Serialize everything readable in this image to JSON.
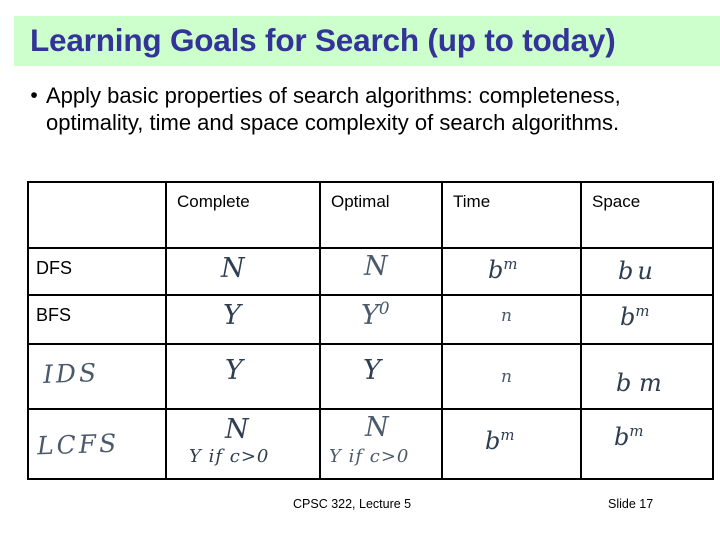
{
  "slide": {
    "title": "Learning Goals for Search  (up to today)",
    "banner_color": "#ccffcc",
    "title_color": "#333399"
  },
  "bullets": [
    {
      "marker": "•",
      "text": "Apply basic properties of search algorithms: completeness, optimality, time and space complexity of search algorithms."
    }
  ],
  "table": {
    "corner_label": "",
    "columns": [
      "Complete",
      "Optimal",
      "Time",
      "Space"
    ],
    "rows": [
      {
        "label": "DFS",
        "label_handwritten": false,
        "cells": [
          {
            "main": "N",
            "sup": "",
            "cond": ""
          },
          {
            "main": "N",
            "sup": "",
            "cond": ""
          },
          {
            "main": "b",
            "sup": "m",
            "cond": ""
          },
          {
            "main": "b",
            "sup": "",
            "cond": "",
            "extra": "u"
          }
        ]
      },
      {
        "label": "BFS",
        "label_handwritten": false,
        "cells": [
          {
            "main": "Y",
            "sup": "",
            "cond": ""
          },
          {
            "main": "Y",
            "sup": "0",
            "cond": ""
          },
          {
            "main": "n",
            "sup": "",
            "cond": ""
          },
          {
            "main": "b",
            "sup": "m",
            "cond": ""
          }
        ]
      },
      {
        "label": "IDS",
        "label_handwritten": true,
        "cells": [
          {
            "main": "Y",
            "sup": "",
            "cond": ""
          },
          {
            "main": "Y",
            "sup": "",
            "cond": ""
          },
          {
            "main": "n",
            "sup": "",
            "cond": ""
          },
          {
            "main": "b m",
            "sup": "",
            "cond": ""
          }
        ]
      },
      {
        "label": "LCFS",
        "label_handwritten": true,
        "cells": [
          {
            "main": "N",
            "sup": "",
            "cond": "Y if c>0"
          },
          {
            "main": "N",
            "sup": "",
            "cond": "Y if c>0"
          },
          {
            "main": "b",
            "sup": "m",
            "cond": ""
          },
          {
            "main": "b",
            "sup": "m",
            "cond": ""
          }
        ]
      }
    ]
  },
  "footer": {
    "course": "CPSC 322, Lecture 5",
    "slide_number": "Slide 17"
  }
}
